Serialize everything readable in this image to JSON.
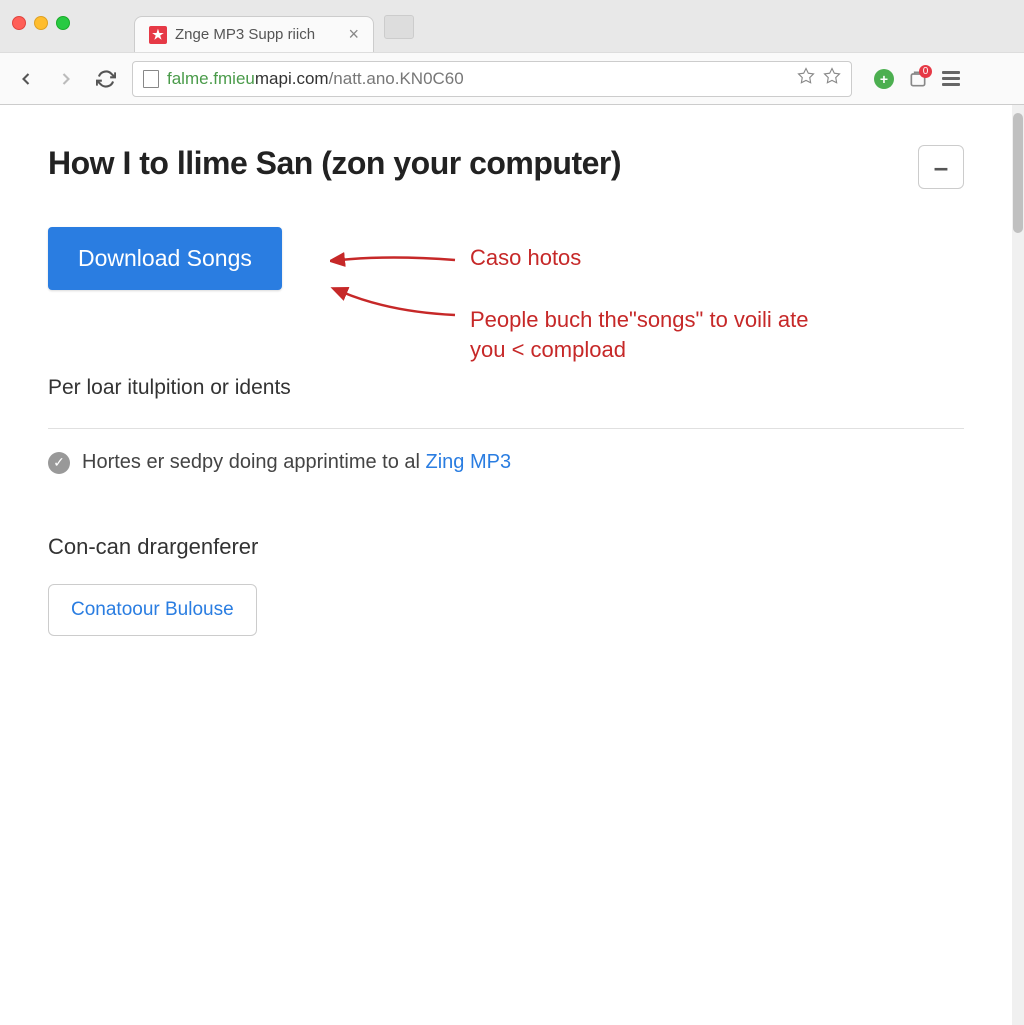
{
  "window": {
    "tab": {
      "title": "Znge MP3 Supp riich",
      "favicon_glyph": "★"
    }
  },
  "toolbar": {
    "url_secure": "falme.fmieu",
    "url_domain": "mapi.com",
    "url_path": "/natt.ano.KN0C60",
    "notif_count": "0"
  },
  "page": {
    "title": "How I to llime San (zon your computer)",
    "collapse_glyph": "–",
    "download_button": "Download Songs",
    "annotation1": "Caso  hotos",
    "annotation2": "People buch the\"songs\" to voili ate you < compload",
    "subheading1": "Per loar itulpition or idents",
    "check_text_before": "Hortes er sedpy doing apprintime to al ",
    "check_link": "Zing MP3",
    "subheading2": "Con-can drargenferer",
    "secondary_button": "Conatoour Bulouse"
  }
}
